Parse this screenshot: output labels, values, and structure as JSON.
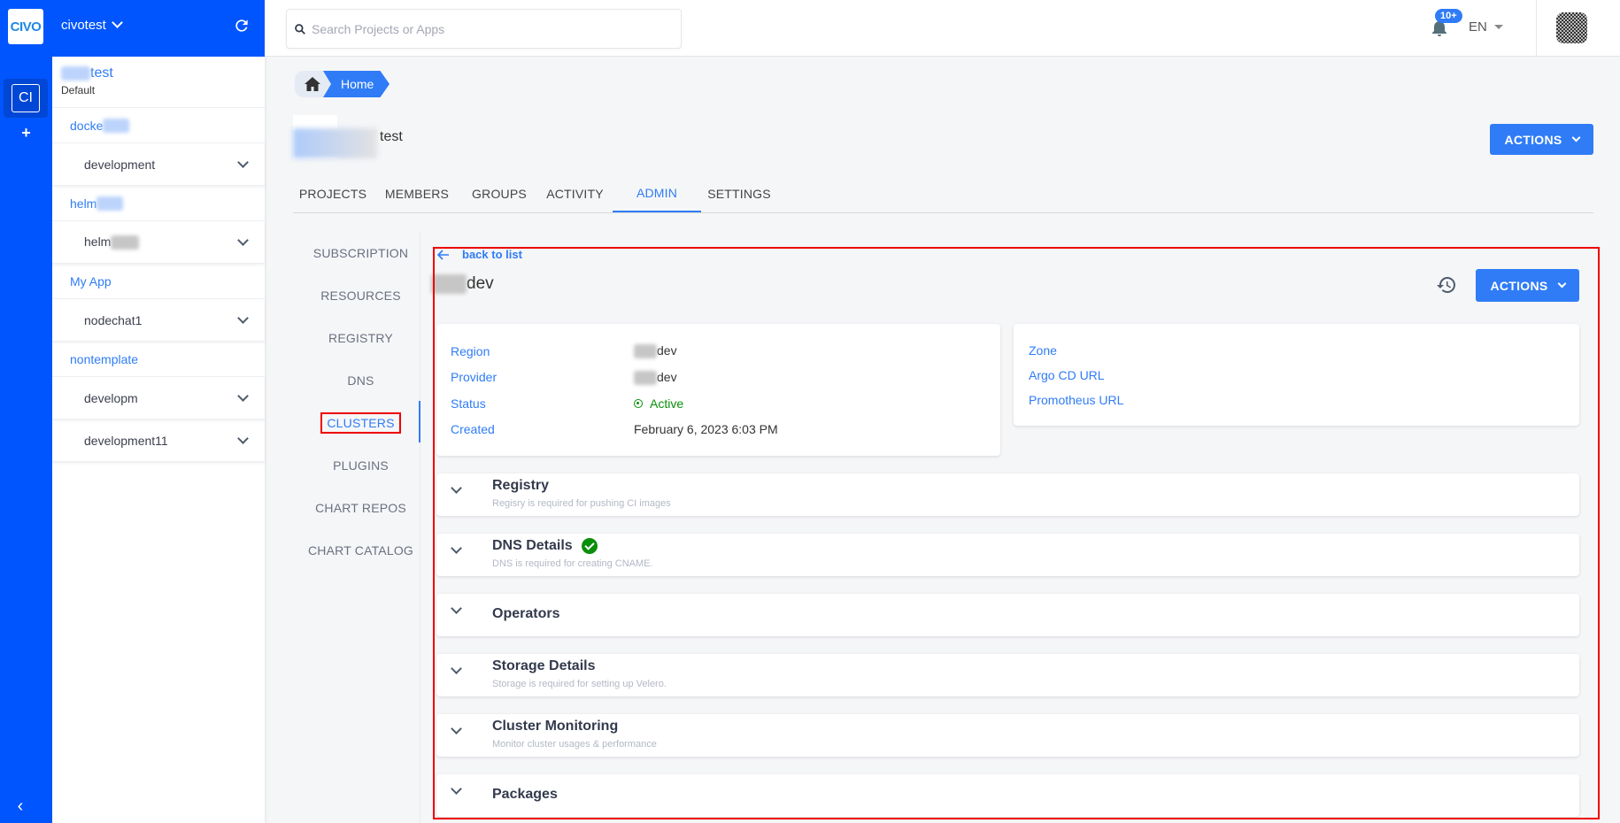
{
  "rail": {
    "logo_text": "CIVO",
    "org_chip": "CI",
    "add_label": "+",
    "collapse_label": "‹"
  },
  "panel": {
    "org_switcher": "civotest",
    "team": {
      "name_suffix": "test",
      "subtitle": "Default"
    },
    "projects": [
      {
        "title_prefix": "docke",
        "apps": [
          {
            "name": "development",
            "blurred_suffix": false
          }
        ]
      },
      {
        "title_prefix": "helm",
        "apps": [
          {
            "name": "helm",
            "blurred_suffix": true
          }
        ]
      },
      {
        "title_prefix": "My App",
        "apps": [
          {
            "name": "nodechat1",
            "blurred_suffix": false
          }
        ]
      },
      {
        "title_prefix": "nontemplate",
        "apps": [
          {
            "name": "developm",
            "blurred_suffix": false
          },
          {
            "name": "development11",
            "blurred_suffix": false
          }
        ]
      }
    ]
  },
  "topbar": {
    "search_placeholder": "Search Projects or Apps",
    "notifications_badge": "10+",
    "language": "EN"
  },
  "breadcrumb": {
    "current": "Home"
  },
  "org_header": {
    "name_suffix": "test",
    "actions_label": "ACTIONS"
  },
  "tabs": [
    {
      "label": "PROJECTS",
      "active": false
    },
    {
      "label": "MEMBERS",
      "active": false
    },
    {
      "label": "GROUPS",
      "active": false
    },
    {
      "label": "ACTIVITY",
      "active": false
    },
    {
      "label": "ADMIN",
      "active": true
    },
    {
      "label": "SETTINGS",
      "active": false
    }
  ],
  "subnav": [
    {
      "label": "SUBSCRIPTION",
      "active": false
    },
    {
      "label": "RESOURCES",
      "active": false
    },
    {
      "label": "REGISTRY",
      "active": false
    },
    {
      "label": "DNS",
      "active": false
    },
    {
      "label": "CLUSTERS",
      "active": true
    },
    {
      "label": "PLUGINS",
      "active": false
    },
    {
      "label": "CHART REPOS",
      "active": false
    },
    {
      "label": "CHART CATALOG",
      "active": false
    }
  ],
  "cluster": {
    "back_label": "back to list",
    "title_suffix": "dev",
    "actions_label": "ACTIONS",
    "details": [
      {
        "key": "Region",
        "value": "dev",
        "blurred_prefix": true
      },
      {
        "key": "Provider",
        "value": "dev",
        "blurred_prefix": true
      },
      {
        "key": "Status",
        "value": "Active",
        "status": "active"
      },
      {
        "key": "Created",
        "value": "February 6, 2023 6:03 PM"
      }
    ],
    "links": [
      "Zone",
      "Argo CD URL",
      "Promotheus URL"
    ],
    "sections": [
      {
        "title": "Registry",
        "subtitle": "Regisry is required for pushing CI images",
        "verified": false
      },
      {
        "title": "DNS Details",
        "subtitle": "DNS is required for creating CNAME.",
        "verified": true
      },
      {
        "title": "Operators",
        "subtitle": "",
        "verified": false
      },
      {
        "title": "Storage Details",
        "subtitle": "Storage is required for setting up Velero.",
        "verified": false
      },
      {
        "title": "Cluster Monitoring",
        "subtitle": "Monitor cluster usages & performance",
        "verified": false
      },
      {
        "title": "Packages",
        "subtitle": "",
        "verified": false
      }
    ]
  },
  "colors": {
    "brand": "#0055fe",
    "accent": "#2f7cf6",
    "success": "#0a8f0a",
    "highlight": "#ee0000"
  }
}
